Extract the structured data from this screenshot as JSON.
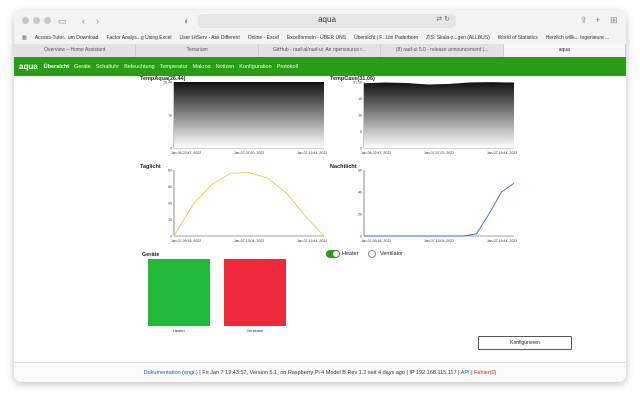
{
  "browser": {
    "url": "aqua",
    "bookmarks": [
      "Access-Tutor...um Download",
      "Factor Analys...g Using Excel",
      "User LitServ - Ask Different",
      "Online - Excel",
      "Excelformeln - ÜBER UNS",
      "Übersicht | F...Uni Paderborn",
      "ZIS: Skala-z...gen (ALLBUS)",
      "World of Statistics",
      "Herzlich willk... Ingenieure ..."
    ],
    "tabs": [
      {
        "label": "Overview – Home Assistant",
        "active": false
      },
      {
        "label": "Terrarium",
        "active": false
      },
      {
        "label": "GitHub - raaf-al/raaf-ui: An opensource r...",
        "active": false
      },
      {
        "label": "(8) raaf-ui 5.0 - release announcement |...",
        "active": false
      },
      {
        "label": "aqua",
        "active": true
      }
    ]
  },
  "nav": {
    "brand": "aqua",
    "items": [
      "Übersicht",
      "Geräte",
      "Schaltuhr",
      "Beleuchtung",
      "Temperatur",
      "Makros",
      "Notizen",
      "Konfiguration",
      "Protokoll"
    ]
  },
  "charts": {
    "temp_aqua": {
      "title": "TempAqua(26.44)"
    },
    "temp_case": {
      "title": "TempCase(31.06)"
    },
    "taglicht": {
      "title": "Taglicht"
    },
    "nachtlicht": {
      "title": "Nachtlicht"
    }
  },
  "chart_data": [
    {
      "type": "area",
      "title": "TempAqua(26.44)",
      "x": [
        "Jan-06-22:47, 2022",
        "Jan-07-07:20, 2022",
        "Jan-07-19:44, 2022"
      ],
      "ylim": [
        0,
        26.44
      ],
      "yticks": [
        "26.44",
        "1e",
        "0"
      ],
      "series": [
        {
          "values": [
            26.44,
            26.44,
            26.44
          ]
        }
      ]
    },
    {
      "type": "area",
      "title": "TempCase(31.06)",
      "x": [
        "Jan-06-22:47, 2022",
        "Jan-07-07:22, 2022",
        "Jan-07-19:44, 2022"
      ],
      "ylim": [
        0,
        31.06
      ],
      "yticks": [
        "31.06",
        "15",
        "10",
        "5",
        "0"
      ],
      "series": [
        {
          "values": [
            30.5,
            30.8,
            30.6,
            29.9,
            30.2,
            30.9,
            31.0,
            30.8
          ]
        }
      ]
    },
    {
      "type": "line",
      "title": "Taglicht",
      "x": [
        "Jan-07-09:18, 2022",
        "Jan-07-13:04, 2022",
        "Jan-07-19:44, 2022"
      ],
      "ylim": [
        0,
        80
      ],
      "yticks": [
        "80",
        "60",
        "40",
        "20",
        "0"
      ],
      "series": [
        {
          "values": [
            0,
            38,
            62,
            76,
            77,
            70,
            52,
            24,
            0
          ]
        }
      ]
    },
    {
      "type": "line",
      "title": "Nachtlicht",
      "x": [
        "Jan-07-09:18, 2022",
        "Jan-07-13:04, 2022",
        "Jan-07-19:44, 2022"
      ],
      "ylim": [
        0,
        60
      ],
      "yticks": [
        "60",
        "40",
        "20",
        "0"
      ],
      "series": [
        {
          "values": [
            0,
            0,
            0,
            0,
            0,
            0,
            0,
            0,
            0,
            2,
            20,
            40,
            48
          ]
        }
      ]
    }
  ],
  "devices": {
    "title": "Geräte",
    "heater_label": "Heater",
    "ventilator_label": "Ventilator",
    "heater_color": "#22b83a",
    "ventilator_color": "#f0293a"
  },
  "controls": {
    "heater_toggle_label": "Heater",
    "ventilator_radio_label": "Ventilator",
    "config_button": "Konfigurieren"
  },
  "footer": {
    "doc_link": "Dokumentation (engl.)",
    "status": "| Fri Jan 7 19:43:57,  Version 5.1, on Raspberry Pi 4 Model B Rev 1.2  seit 4 days ago | IP 192.168.115.117 |",
    "api_link": "API",
    "sep": "|",
    "error_link": "Fehler(0)"
  }
}
